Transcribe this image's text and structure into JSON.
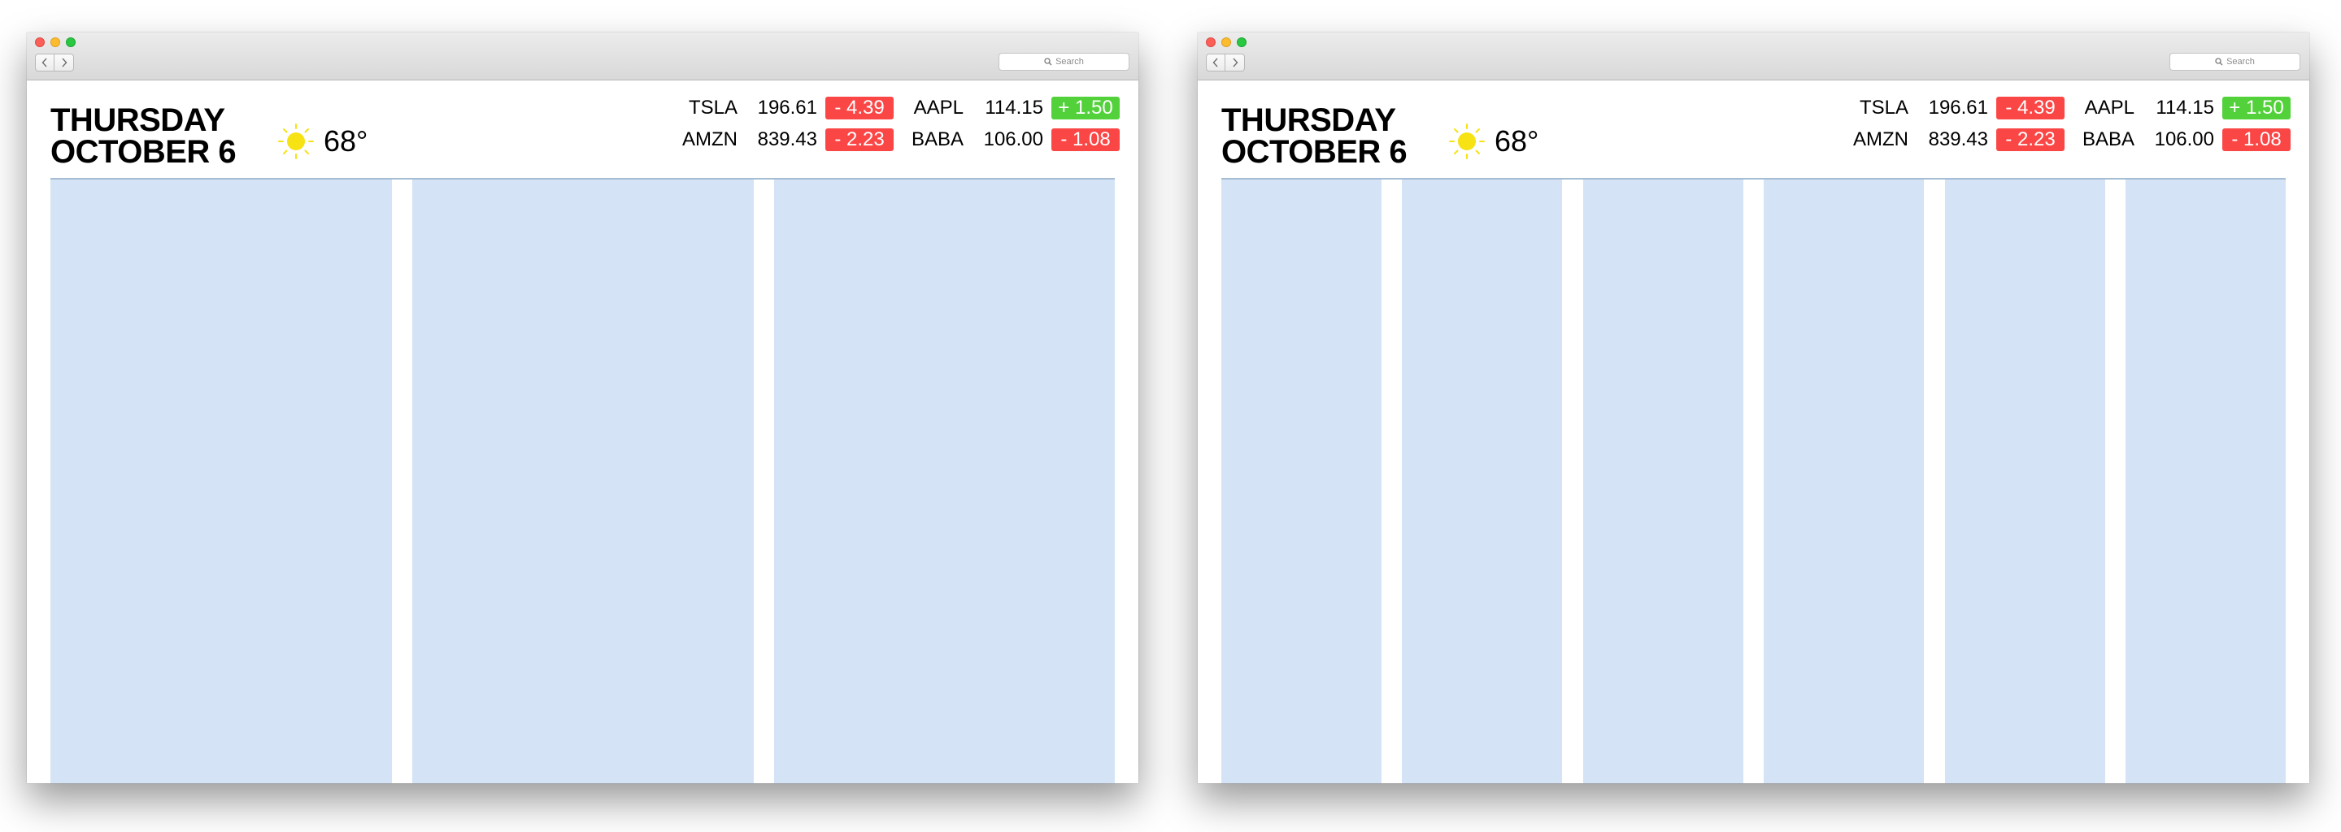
{
  "colors": {
    "column_fill": "#d4e4f6",
    "negative_change": "#fb4646",
    "positive_change": "#52d13a",
    "sun": "#f7e214"
  },
  "windows": [
    {
      "search": {
        "placeholder": "Search",
        "icon": "search-icon"
      },
      "nav": {
        "back_icon": "chevron-left-icon",
        "forward_icon": "chevron-right-icon"
      },
      "header": {
        "day": "THURSDAY",
        "date": "OCTOBER 6",
        "weather": {
          "icon": "sun-icon",
          "temperature": "68°"
        }
      },
      "stocks": [
        {
          "ticker": "TSLA",
          "price": "196.61",
          "change": "- 4.39",
          "direction": "down"
        },
        {
          "ticker": "AAPL",
          "price": "114.15",
          "change": "+ 1.50",
          "direction": "up"
        },
        {
          "ticker": "AMZN",
          "price": "839.43",
          "change": "- 2.23",
          "direction": "down"
        },
        {
          "ticker": "BABA",
          "price": "106.00",
          "change": "- 1.08",
          "direction": "down"
        }
      ],
      "grid_columns": 3
    },
    {
      "search": {
        "placeholder": "Search",
        "icon": "search-icon"
      },
      "nav": {
        "back_icon": "chevron-left-icon",
        "forward_icon": "chevron-right-icon"
      },
      "header": {
        "day": "THURSDAY",
        "date": "OCTOBER 6",
        "weather": {
          "icon": "sun-icon",
          "temperature": "68°"
        }
      },
      "stocks": [
        {
          "ticker": "TSLA",
          "price": "196.61",
          "change": "- 4.39",
          "direction": "down"
        },
        {
          "ticker": "AAPL",
          "price": "114.15",
          "change": "+ 1.50",
          "direction": "up"
        },
        {
          "ticker": "AMZN",
          "price": "839.43",
          "change": "- 2.23",
          "direction": "down"
        },
        {
          "ticker": "BABA",
          "price": "106.00",
          "change": "- 1.08",
          "direction": "down"
        }
      ],
      "grid_columns": 6
    }
  ]
}
